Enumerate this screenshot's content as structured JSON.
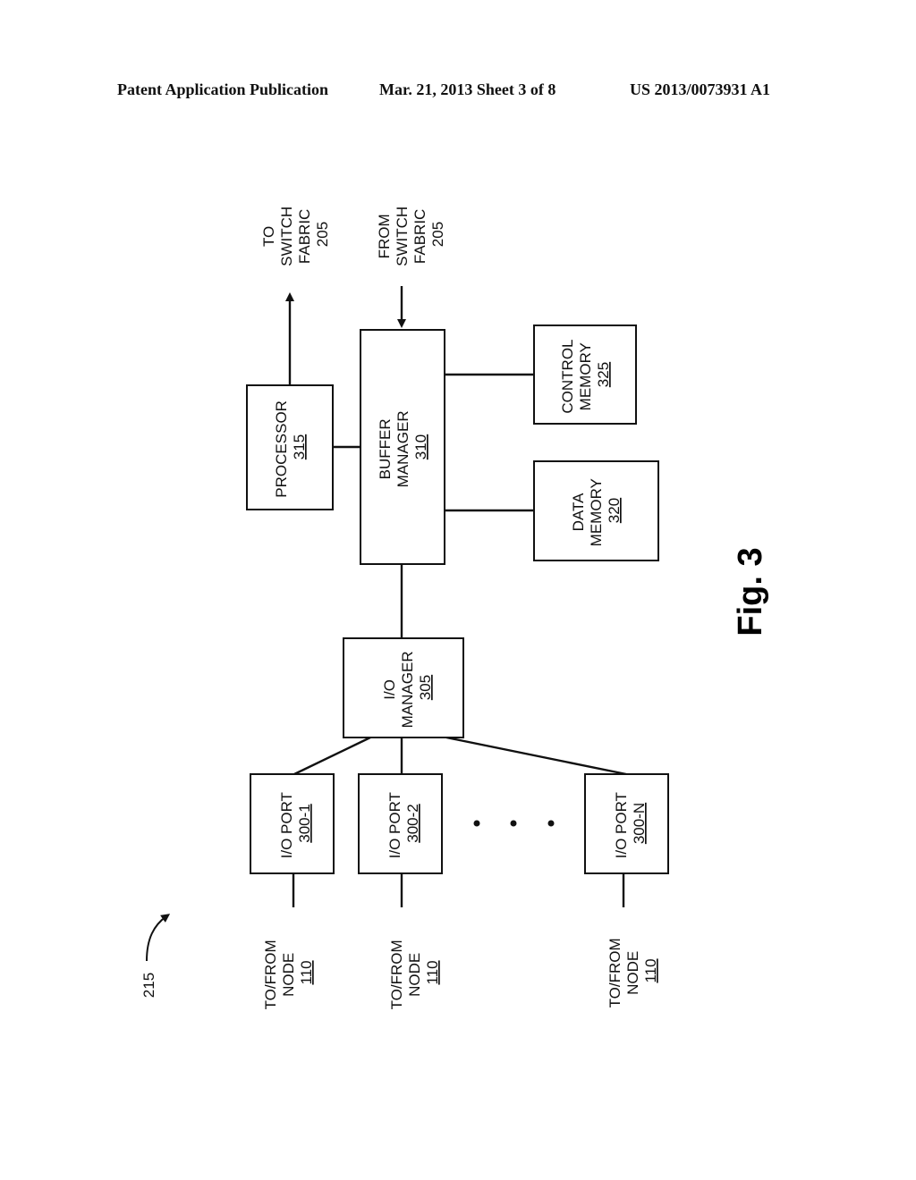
{
  "header": {
    "publication": "Patent Application Publication",
    "date_sheet": "Mar. 21, 2013  Sheet 3 of 8",
    "number": "US 2013/0073931 A1"
  },
  "figure": {
    "label": "Fig. 3",
    "reference": "215",
    "blocks": {
      "processor": {
        "line1": "PROCESSOR",
        "ref": "315"
      },
      "buffer_manager": {
        "line1": "BUFFER",
        "line2": "MANAGER",
        "ref": "310"
      },
      "control_memory": {
        "line1": "CONTROL",
        "line2": "MEMORY",
        "ref": "325"
      },
      "data_memory": {
        "line1": "DATA",
        "line2": "MEMORY",
        "ref": "320"
      },
      "io_manager": {
        "line1": "I/O",
        "line2": "MANAGER",
        "ref": "305"
      },
      "io_ports": [
        {
          "line1": "I/O PORT",
          "ref": "300-1"
        },
        {
          "line1": "I/O PORT",
          "ref": "300-2"
        },
        {
          "line1": "I/O PORT",
          "ref": "300-N"
        }
      ]
    },
    "switch_labels": {
      "to": {
        "line1": "TO",
        "line2": "SWITCH",
        "line3": "FABRIC",
        "ref": "205"
      },
      "from": {
        "line1": "FROM",
        "line2": "SWITCH",
        "line3": "FABRIC",
        "ref": "205"
      }
    },
    "node_labels": [
      {
        "line1": "TO/FROM",
        "line2": "NODE",
        "ref": "110"
      },
      {
        "line1": "TO/FROM",
        "line2": "NODE",
        "ref": "110"
      },
      {
        "line1": "TO/FROM",
        "line2": "NODE",
        "ref": "110"
      }
    ]
  }
}
